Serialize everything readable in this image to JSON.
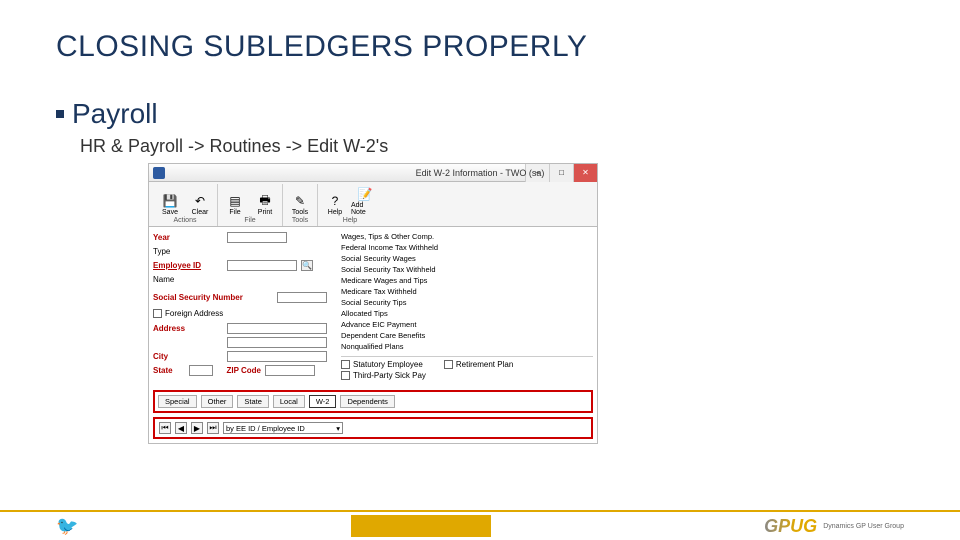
{
  "slide": {
    "title": "CLOSING SUBLEDGERS PROPERLY",
    "section": "Payroll",
    "breadcrumb": "HR & Payroll -> Routines -> Edit W-2's"
  },
  "window": {
    "title": "Edit W-2 Information - TWO (sa)",
    "controls": {
      "min": "–",
      "max": "□",
      "close": "✕"
    }
  },
  "ribbon": {
    "groups": {
      "actions": {
        "label": "Actions",
        "buttons": [
          {
            "name": "save-button",
            "icon": "💾",
            "label": "Save"
          },
          {
            "name": "clear-button",
            "icon": "↶",
            "label": "Clear"
          }
        ]
      },
      "file": {
        "label": "File",
        "buttons": [
          {
            "name": "file-button",
            "icon": "▤",
            "label": "File"
          },
          {
            "name": "print-button",
            "icon": "🖶",
            "label": "Print"
          }
        ]
      },
      "tools": {
        "label": "Tools",
        "buttons": [
          {
            "name": "tools-button",
            "icon": "✎",
            "label": "Tools"
          }
        ]
      },
      "help": {
        "label": "Help",
        "buttons": [
          {
            "name": "help-button",
            "icon": "?",
            "label": "Help"
          },
          {
            "name": "add-note-button",
            "icon": "📝",
            "label": "Add Note"
          }
        ]
      }
    }
  },
  "left": {
    "year": {
      "label": "Year",
      "value": ""
    },
    "type": {
      "label": "Type",
      "value": ""
    },
    "employee_id": {
      "label": "Employee ID",
      "value": ""
    },
    "name": {
      "label": "Name",
      "value": ""
    },
    "ssn": {
      "label": "Social Security Number",
      "value": ""
    },
    "foreign_address": {
      "label": "Foreign Address"
    },
    "address": {
      "label": "Address",
      "value": ""
    },
    "city": {
      "label": "City",
      "value": ""
    },
    "state": {
      "label": "State",
      "value": ""
    },
    "zip": {
      "label": "ZIP Code",
      "value": ""
    }
  },
  "right": {
    "rows": [
      {
        "label": "Wages, Tips & Other Comp.",
        "value": ""
      },
      {
        "label": "Federal Income Tax Withheld",
        "value": ""
      },
      {
        "label": "Social Security Wages",
        "value": ""
      },
      {
        "label": "Social Security Tax Withheld",
        "value": ""
      },
      {
        "label": "Medicare Wages and Tips",
        "value": ""
      },
      {
        "label": "Medicare Tax Withheld",
        "value": ""
      },
      {
        "label": "Social Security Tips",
        "value": ""
      },
      {
        "label": "Allocated Tips",
        "value": ""
      },
      {
        "label": "Advance EIC Payment",
        "value": ""
      },
      {
        "label": "Dependent Care Benefits",
        "value": ""
      },
      {
        "label": "Nonqualified Plans",
        "value": ""
      }
    ],
    "checks": {
      "statutory": "Statutory Employee",
      "retirement": "Retirement Plan",
      "sickpay": "Third-Party Sick Pay"
    }
  },
  "tabs": {
    "items": [
      "Special",
      "Other",
      "State",
      "Local",
      "W-2",
      "Dependents"
    ]
  },
  "bottom": {
    "sort_label": "by EE ID / Employee ID"
  },
  "footer": {
    "logo_text_1": "GPUG",
    "logo_text_2": "Dynamics GP User Group"
  }
}
